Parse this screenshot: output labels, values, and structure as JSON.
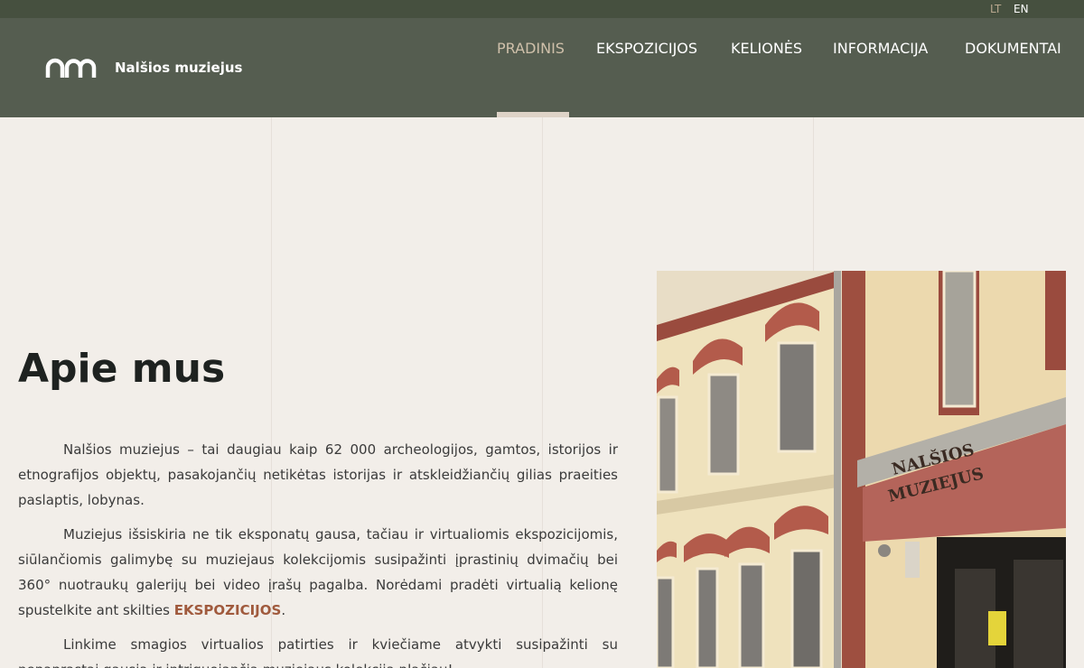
{
  "lang": {
    "lt": "LT",
    "en": "EN"
  },
  "brand": {
    "name": "Nalšios muziejus",
    "mark": "nm"
  },
  "nav": {
    "items": [
      "PRADINIS",
      "EKSPOZICIJOS",
      "KELIONĖS",
      "INFORMACIJA",
      "DOKUMENTAI"
    ],
    "active": "PRADINIS"
  },
  "about": {
    "title": "Apie mus",
    "p1": "Nalšios muziejus – tai daugiau kaip 62 000 archeologijos, gamtos, istorijos ir etnografijos objektų, pasakojančių netikėtas istorijas ir atskleidžiančių gilias praeities paslaptis, lobynas.",
    "p2_before": "Muziejus išsiskiria ne tik eksponatų gausa, tačiau ir virtualiomis ekspozicijomis, siūlančiomis galimybę su muziejaus kolekcijomis susipažinti įprastinių dvimačių bei 360° nuotraukų galerijų bei video įrašų pagalba. Norėdami pradėti virtualią kelionę spustelkite ant skilties ",
    "p2_link": "EKSPOZICIJOS",
    "p2_after": ".",
    "p3": "Linkime smagios virtualios patirties ir kviečiame atvykti susipažinti su nepaprastai gausia ir intriguojančia muziejaus kolekcija plačiau!"
  },
  "photo": {
    "sign_line1": "NALŠIOS",
    "sign_line2": "MUZIEJUS"
  },
  "colors": {
    "topbar": "#46503f",
    "header": "#555d50",
    "accent": "#cfc0aa",
    "link": "#a05a3d",
    "bg": "#f2eee9"
  }
}
